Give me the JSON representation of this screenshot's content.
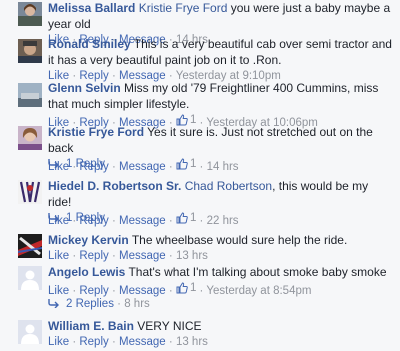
{
  "actions": {
    "like": "Like",
    "reply": "Reply",
    "message": "Message",
    "dot": "·"
  },
  "comments": [
    {
      "author": "Melissa Ballard",
      "mention": "Kristie Frye Ford",
      "text": " you were just a baby maybe a year old",
      "likes": "",
      "time": "14 hrs",
      "avatar_icon": "user-photo"
    },
    {
      "author": "Ronald Smiley",
      "mention": "",
      "text": " This is a very beautiful cab over semi tractor and it has a very beautiful paint job on it to .Ron.",
      "likes": "",
      "time": "Yesterday at 9:10pm",
      "avatar_icon": "user-photo"
    },
    {
      "author": "Glenn Selvin",
      "mention": "",
      "text": " Miss my old '79 Freightliner 400 Cummins, miss that much simpler lifestyle.",
      "likes": "1",
      "time": "Yesterday at 10:06pm",
      "avatar_icon": "user-photo"
    },
    {
      "author": "Kristie Frye Ford",
      "mention": "",
      "text": " Yes it sure is. Just not stretched out on the back",
      "likes": "1",
      "time": "14 hrs",
      "reply_label": "1 Reply",
      "avatar_icon": "user-photo"
    },
    {
      "author": "Hiedel D. Robertson Sr.",
      "mention": "Chad Robertson",
      "text": ", this would be my ride!",
      "likes": "1",
      "time": "22 hrs",
      "reply_label": "1 Reply",
      "avatar_icon": "user-photo"
    },
    {
      "author": "Mickey Kervin",
      "mention": "",
      "text": " The wheelbase would sure help the ride.",
      "likes": "",
      "time": "13 hrs",
      "avatar_icon": "user-photo"
    },
    {
      "author": "Angelo Lewis",
      "mention": "",
      "text": " That's what I'm talking about smoke baby smoke",
      "likes": "1",
      "time": "Yesterday at 8:54pm",
      "reply_label": "2 Replies",
      "reply_time": "8 hrs",
      "avatar_icon": "default-avatar"
    },
    {
      "author": "William E. Bain",
      "mention": "",
      "text": " VERY NICE",
      "likes": "",
      "time": "13 hrs",
      "avatar_icon": "default-avatar"
    }
  ]
}
